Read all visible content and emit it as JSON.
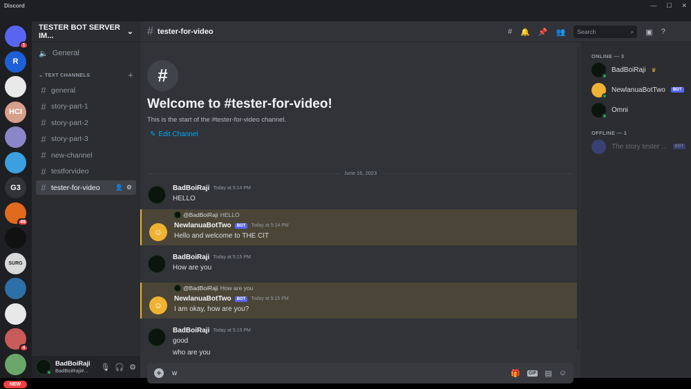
{
  "app_title": "Discord",
  "window_controls": [
    "—",
    "☐",
    "✕"
  ],
  "rail": {
    "servers": [
      {
        "label": "",
        "badge": "1",
        "color": "#5865f2"
      },
      {
        "label": "R",
        "badge": "",
        "color": "#1d5fd6"
      },
      {
        "label": "",
        "badge": "",
        "color": "#e9e9e9"
      },
      {
        "label": "HCI",
        "badge": "",
        "color": "#d7a08c"
      },
      {
        "label": "",
        "badge": "",
        "color": "#8a86c8"
      },
      {
        "label": "",
        "badge": "",
        "color": "#3aa0e0"
      },
      {
        "label": "G3",
        "badge": "",
        "color": "#313338"
      },
      {
        "label": "",
        "badge": "49",
        "color": "#e06a1d"
      },
      {
        "label": "",
        "badge": "",
        "color": "#111111"
      },
      {
        "label": "SURG",
        "badge": "",
        "color": "#d9d9d9"
      },
      {
        "label": "",
        "badge": "",
        "color": "#2d6fa8"
      },
      {
        "label": "",
        "badge": "",
        "color": "#e8e8e8"
      },
      {
        "label": "",
        "badge": "4",
        "color": "#c85a5a"
      },
      {
        "label": "",
        "badge": "",
        "color": "#6aa66a"
      }
    ],
    "new_label": "NEW"
  },
  "server": {
    "name": "TESTER BOT SERVER IM...",
    "voice_channel": "General",
    "category": "TEXT CHANNELS",
    "channels": [
      "general",
      "story-part-1",
      "story-part-2",
      "story-part-3",
      "new-channel",
      "testforvideo",
      "tester-for-video"
    ],
    "active_channel": "tester-for-video"
  },
  "user": {
    "name": "BadBoiRaji",
    "tag": "BadBoiRaji#..."
  },
  "channel_header": {
    "title": "tester-for-video",
    "search_placeholder": "Search"
  },
  "welcome": {
    "title": "Welcome to #tester-for-video!",
    "subtitle": "This is the start of the #tester-for-video channel.",
    "edit": "Edit Channel"
  },
  "date_divider": "June 16, 2023",
  "messages": [
    {
      "author": "BadBoiRaji",
      "time": "Today at 5:14 PM",
      "lines": [
        "HELLO"
      ],
      "bot": false,
      "reply": null
    },
    {
      "author": "NewlanuaBotTwo",
      "time": "Today at 5:14 PM",
      "lines": [
        "Hello and welcome to THE CIT"
      ],
      "bot": true,
      "reply": {
        "to": "@BadBoiRaji",
        "text": "HELLO"
      }
    },
    {
      "author": "BadBoiRaji",
      "time": "Today at 5:15 PM",
      "lines": [
        "How are you"
      ],
      "bot": false,
      "reply": null
    },
    {
      "author": "NewlanuaBotTwo",
      "time": "Today at 5:15 PM",
      "lines": [
        "I am okay, how are you?"
      ],
      "bot": true,
      "reply": {
        "to": "@BadBoiRaji",
        "text": "How are you"
      }
    },
    {
      "author": "BadBoiRaji",
      "time": "Today at 5:15 PM",
      "lines": [
        "good",
        "who are you"
      ],
      "bot": false,
      "reply": null
    }
  ],
  "bot_tag": "BOT",
  "composer": {
    "value": "w",
    "gif": "GIF"
  },
  "members": {
    "online_header": "ONLINE — 3",
    "offline_header": "OFFLINE — 1",
    "online": [
      {
        "name": "BadBoiRaji",
        "bot": false,
        "crown": true
      },
      {
        "name": "NewlanuaBotTwo",
        "bot": true,
        "crown": false
      },
      {
        "name": "Omni",
        "bot": false,
        "crown": false
      }
    ],
    "offline": [
      {
        "name": "The story tester ...",
        "bot": true
      }
    ]
  }
}
